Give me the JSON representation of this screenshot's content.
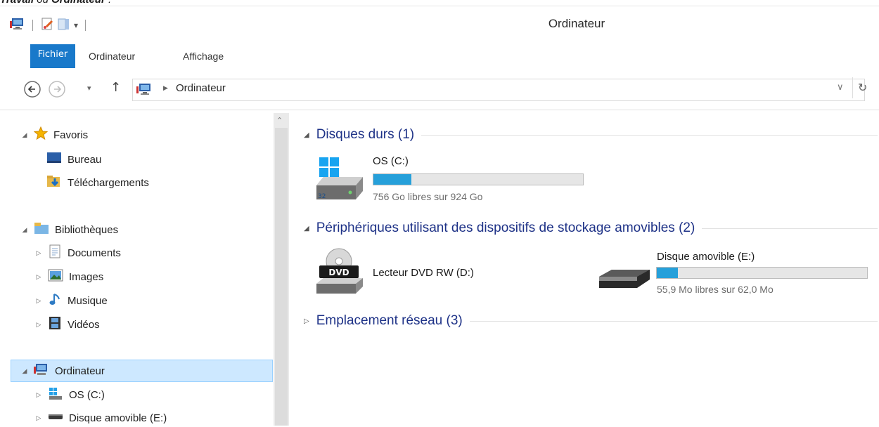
{
  "caption": {
    "bold": "Travail",
    "mid": " ou ",
    "bold2": "Ordinateur",
    "end": " :"
  },
  "window": {
    "title": "Ordinateur"
  },
  "ribbon": {
    "tabs": [
      "Fichier",
      "Ordinateur",
      "Affichage"
    ]
  },
  "address": {
    "path": "Ordinateur"
  },
  "nav": {
    "favoris": "Favoris",
    "bureau": "Bureau",
    "telechargements": "Téléchargements",
    "bibliotheques": "Bibliothèques",
    "documents": "Documents",
    "images": "Images",
    "musique": "Musique",
    "videos": "Vidéos",
    "ordinateur": "Ordinateur",
    "os": "OS (C:)",
    "amovible": "Disque amovible (E:)"
  },
  "content": {
    "groups": {
      "hdd": "Disques durs (1)",
      "removable": "Périphériques utilisant des dispositifs de stockage amovibles (2)",
      "network": "Emplacement réseau (3)"
    },
    "drives": {
      "os": {
        "name": "OS (C:)",
        "free": "756 Go libres sur 924 Go",
        "used_fraction": 0.18
      },
      "dvd": {
        "name": "Lecteur DVD RW (D:)",
        "badge": "DVD"
      },
      "usb": {
        "name": "Disque amovible (E:)",
        "free": "55,9 Mo libres sur 62,0 Mo",
        "used_fraction": 0.1
      }
    }
  },
  "colors": {
    "accent": "#1979ca",
    "bar_fill": "#26a0da",
    "group_heading": "#1e3287",
    "selection": "#cde8ff"
  }
}
